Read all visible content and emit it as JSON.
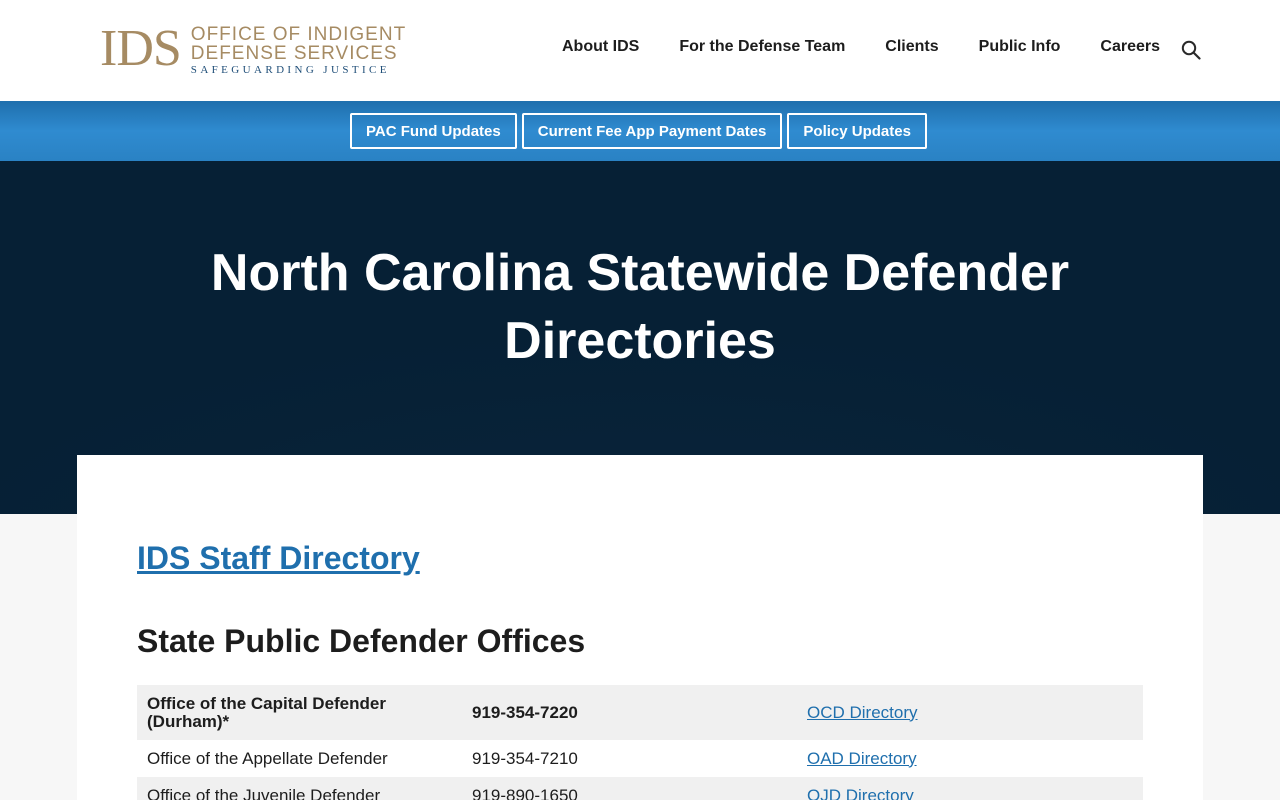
{
  "header": {
    "logo": {
      "mark": "IDS",
      "line1": "OFFICE OF INDIGENT",
      "line2": "DEFENSE SERVICES",
      "line3": "SAFEGUARDING JUSTICE"
    },
    "nav": [
      {
        "label": "About IDS"
      },
      {
        "label": "For the Defense Team"
      },
      {
        "label": "Clients"
      },
      {
        "label": "Public Info"
      },
      {
        "label": "Careers"
      }
    ],
    "search_icon": "search-icon"
  },
  "quick_links": [
    {
      "label": "PAC Fund Updates"
    },
    {
      "label": "Current Fee App Payment Dates"
    },
    {
      "label": "Policy Updates"
    }
  ],
  "hero": {
    "title": "North Carolina Statewide Defender Directories"
  },
  "content": {
    "staff_link": "IDS Staff Directory",
    "section_title": "State Public Defender Offices",
    "offices": [
      {
        "name": "Office of the Capital Defender (Durham)*",
        "phone": "919-354-7220",
        "link": "OCD Directory"
      },
      {
        "name": "Office of the Appellate Defender",
        "phone": "919-354-7210",
        "link": "OAD Directory"
      },
      {
        "name": "Office of the Juvenile Defender",
        "phone": "919-890-1650",
        "link": "OJD Directory"
      }
    ]
  },
  "colors": {
    "brand_gold": "#a68b63",
    "brand_blue": "#1f6fad",
    "hero_navy": "#062035"
  }
}
